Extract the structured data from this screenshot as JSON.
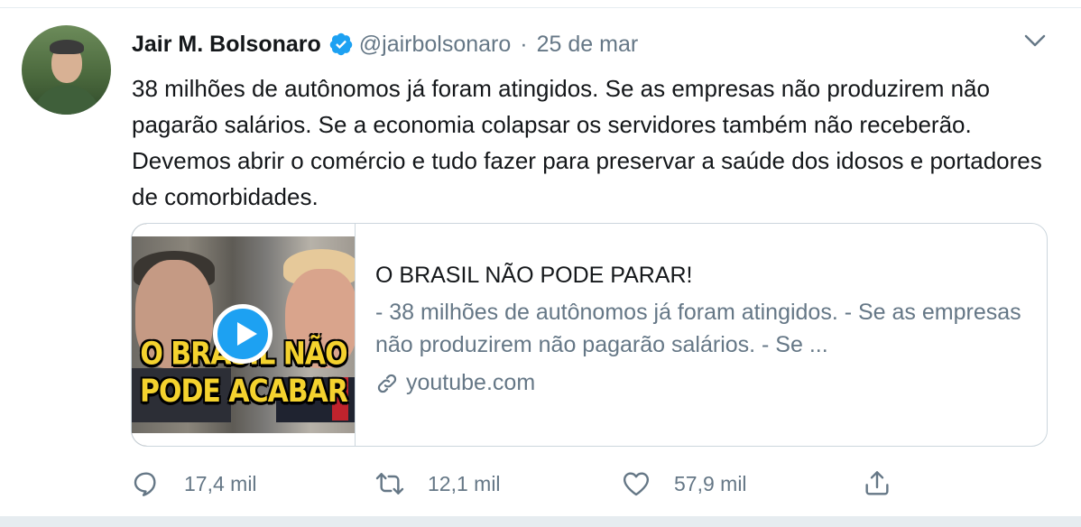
{
  "tweet": {
    "author_name": "Jair M. Bolsonaro",
    "handle": "@jairbolsonaro",
    "separator": "·",
    "date": "25 de mar",
    "text": "38 milhões de autônomos já foram atingidos. Se as empresas não produzirem não pagarão salários. Se a economia colapsar os servidores também não receberão. Devemos abrir o comércio e tudo fazer para preservar a saúde dos idosos e portadores de comorbidades."
  },
  "card": {
    "thumbnail_caption": "O BRASIL NÃO PODE ACABAR",
    "title": "O BRASIL NÃO PODE PARAR!",
    "description": "- 38 milhões de autônomos já foram atingidos. - Se as empresas não produzirem não pagarão salários. - Se ...",
    "domain": "youtube.com"
  },
  "actions": {
    "replies": "17,4 mil",
    "retweets": "12,1 mil",
    "likes": "57,9 mil"
  },
  "icons": {
    "verified": "verified-badge-icon",
    "menu": "chevron-down-icon",
    "link": "link-icon",
    "reply": "reply-icon",
    "retweet": "retweet-icon",
    "like": "heart-icon",
    "share": "share-icon",
    "play": "play-icon"
  },
  "colors": {
    "accent": "#1da1f2",
    "text_primary": "#14171a",
    "text_secondary": "#657786",
    "border": "#ccd6dd"
  }
}
